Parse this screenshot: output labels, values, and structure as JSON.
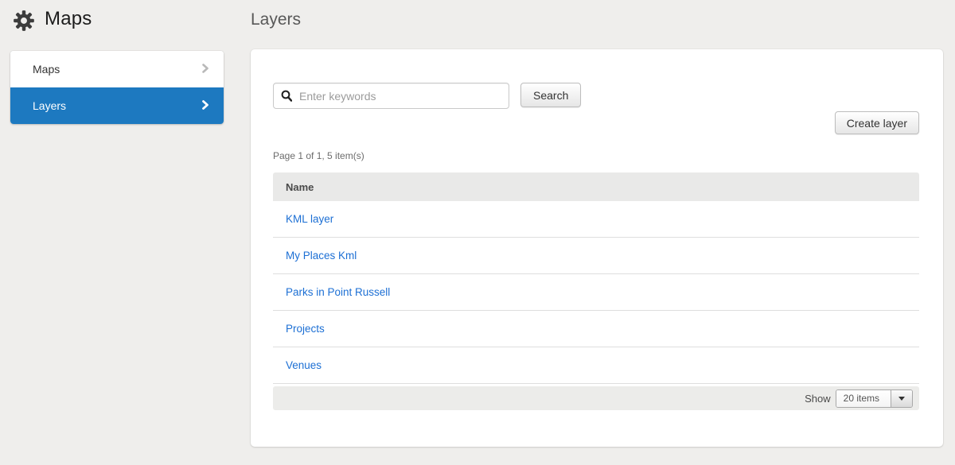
{
  "header": {
    "app_title": "Maps",
    "page_title": "Layers"
  },
  "sidebar": {
    "items": [
      {
        "label": "Maps",
        "active": false
      },
      {
        "label": "Layers",
        "active": true
      }
    ]
  },
  "main": {
    "search": {
      "placeholder": "Enter keywords",
      "value": "",
      "button_label": "Search"
    },
    "create_button_label": "Create layer",
    "pagination_summary": "Page 1 of 1, 5 item(s)",
    "table": {
      "columns": [
        "Name"
      ],
      "rows": [
        {
          "name": "KML layer"
        },
        {
          "name": "My Places Kml"
        },
        {
          "name": "Parks in Point Russell"
        },
        {
          "name": "Projects"
        },
        {
          "name": "Venues"
        }
      ]
    },
    "footer": {
      "show_label": "Show",
      "page_size": "20 items"
    }
  },
  "colors": {
    "body_bg": "#efeeec",
    "sidebar_active_bg": "#1d79c0",
    "link_blue": "#1c6fd4",
    "table_header_bg": "#e9e9e8",
    "footer_bar_bg": "#ececea"
  }
}
